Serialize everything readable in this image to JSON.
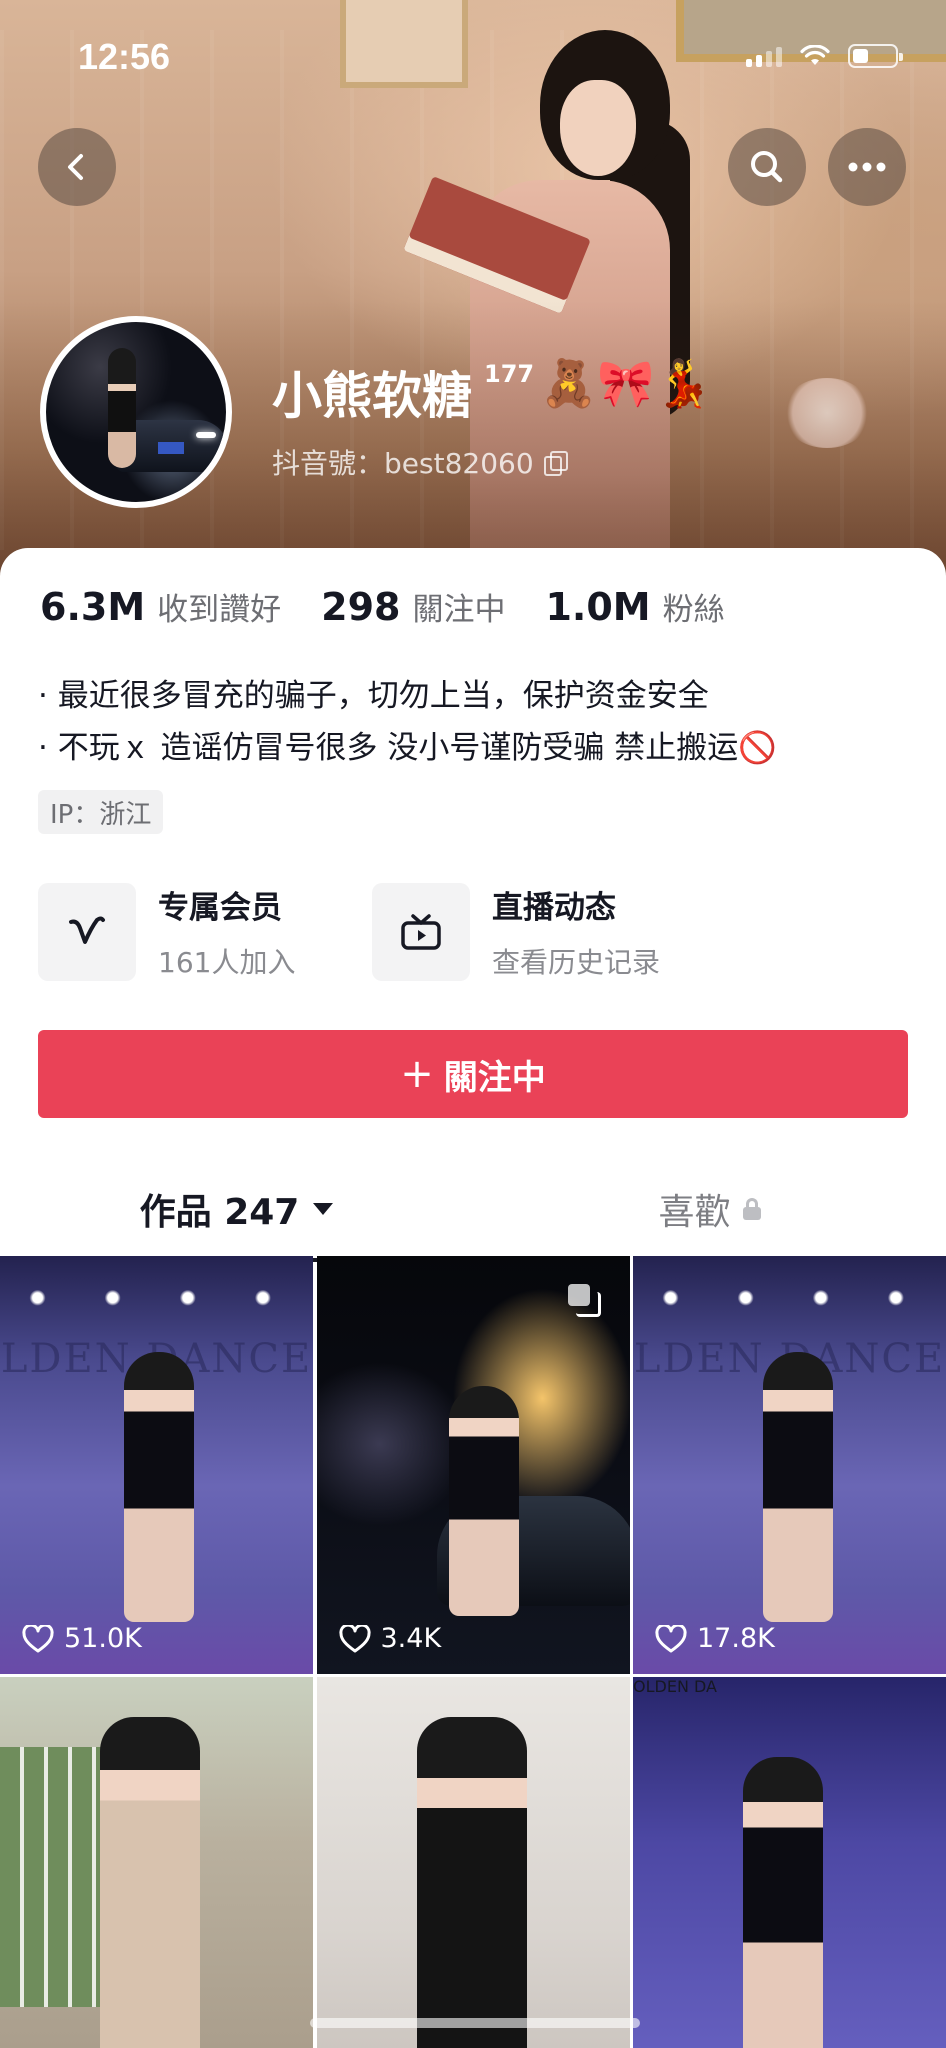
{
  "status_bar": {
    "time": "12:56"
  },
  "profile": {
    "name": "小熊软糖",
    "level": "177",
    "name_emoji": "🧸🎀💃",
    "handle": "抖音號：best82060"
  },
  "stats": [
    {
      "value": "6.3M",
      "label": "收到讚好"
    },
    {
      "value": "298",
      "label": "關注中"
    },
    {
      "value": "1.0M",
      "label": "粉絲"
    }
  ],
  "bio": [
    "· 最近很多冒充的骗子，切勿上当，保护资金安全",
    "· 不玩ｘ 造谣仿冒号很多 没小号谨防受骗 禁止搬运🚫"
  ],
  "ip": "IP：浙江",
  "services": {
    "member": {
      "title": "专属会员",
      "subtitle": "161人加入"
    },
    "live": {
      "title": "直播动态",
      "subtitle": "查看历史记录"
    }
  },
  "follow_button": {
    "plus": "+",
    "label": "關注中"
  },
  "tabs": {
    "works": "作品 247",
    "likes": "喜歡"
  },
  "videos": [
    {
      "likes": "51.0K",
      "wall_text": "LDEN DANCE"
    },
    {
      "likes": "3.4K"
    },
    {
      "likes": "17.8K",
      "wall_text": "LDEN DANCE"
    },
    {
      "likes": ""
    },
    {
      "likes": ""
    },
    {
      "likes": "",
      "wall_text": "OLDEN DA"
    }
  ],
  "colors": {
    "accent": "#ea4257",
    "text_primary": "#161823",
    "text_secondary": "#6d6e73"
  },
  "icons": [
    "back-icon",
    "search-icon",
    "more-icon",
    "copy-icon",
    "member-v-icon",
    "live-tv-icon",
    "caret-down-icon",
    "lock-icon",
    "heart-icon",
    "multi-image-icon"
  ]
}
